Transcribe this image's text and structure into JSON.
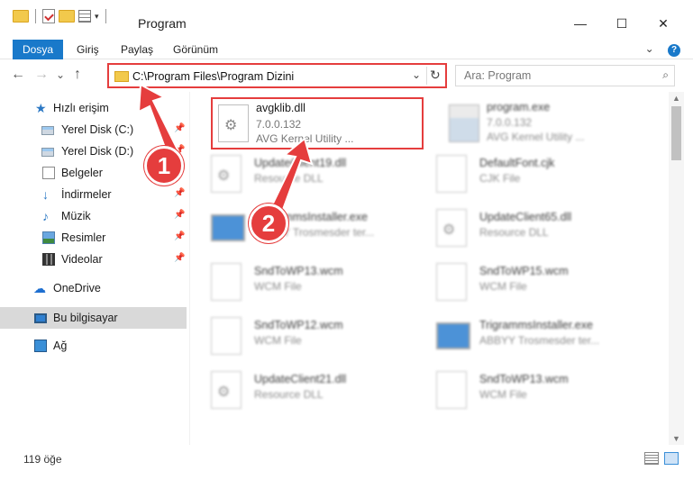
{
  "window": {
    "title": "Program",
    "minimize": "—",
    "maximize": "☐",
    "close": "✕"
  },
  "ribbon": {
    "tabs": [
      "Dosya",
      "Giriş",
      "Paylaş",
      "Görünüm"
    ],
    "expand": "⌄",
    "help": "?"
  },
  "nav": {
    "back": "←",
    "forward": "→",
    "recent": "⌄",
    "up": "↑"
  },
  "address": {
    "path": "C:\\Program Files\\Program Dizini",
    "dropdown": "⌄",
    "refresh": "↻"
  },
  "search": {
    "placeholder": "Ara: Program",
    "icon": "⌕"
  },
  "sidebar": {
    "items": [
      {
        "label": "Hızlı erişim",
        "icon": "star-icon",
        "pinned": false
      },
      {
        "label": "Yerel Disk (C:)",
        "icon": "disk-icon",
        "pinned": true
      },
      {
        "label": "Yerel Disk (D:)",
        "icon": "disk-icon",
        "pinned": true
      },
      {
        "label": "Belgeler",
        "icon": "documents-icon",
        "pinned": true
      },
      {
        "label": "İndirmeler",
        "icon": "download-icon",
        "pinned": true
      },
      {
        "label": "Müzik",
        "icon": "music-icon",
        "pinned": true
      },
      {
        "label": "Resimler",
        "icon": "pictures-icon",
        "pinned": true
      },
      {
        "label": "Videolar",
        "icon": "videos-icon",
        "pinned": true
      },
      {
        "label": "OneDrive",
        "icon": "cloud-icon",
        "pinned": false
      },
      {
        "label": "Bu bilgisayar",
        "icon": "computer-icon",
        "pinned": false,
        "selected": true
      },
      {
        "label": "Ağ",
        "icon": "network-icon",
        "pinned": false
      }
    ],
    "pin_glyph": "📌"
  },
  "files": [
    {
      "name": "avgklib.dll",
      "line1": "7.0.0.132",
      "line2": "AVG Kernel Utility ...",
      "icon": "dll-gear-icon",
      "highlighted": true
    },
    {
      "name": "program.exe",
      "line1": "7.0.0.132",
      "line2": "AVG Kernel Utility ...",
      "icon": "exe-icon"
    },
    {
      "name": "UpdateClient19.dll",
      "line1": "Resource DLL",
      "line2": "",
      "icon": "dll-gear-icon"
    },
    {
      "name": "DefaultFont.cjk",
      "line1": "CJK File",
      "line2": "",
      "icon": "file-icon"
    },
    {
      "name": "TrigrammsInstaller.exe",
      "line1": "ABBYY Trosmesder ter...",
      "line2": "",
      "icon": "installer-icon"
    },
    {
      "name": "UpdateClient65.dll",
      "line1": "Resource DLL",
      "line2": "",
      "icon": "dll-gear-icon"
    },
    {
      "name": "SndToWP13.wcm",
      "line1": "WCM File",
      "line2": "",
      "icon": "file-icon"
    },
    {
      "name": "SndToWP15.wcm",
      "line1": "WCM File",
      "line2": "",
      "icon": "file-icon"
    },
    {
      "name": "SndToWP12.wcm",
      "line1": "WCM File",
      "line2": "",
      "icon": "file-icon"
    },
    {
      "name": "TrigrammsInstaller.exe",
      "line1": "ABBYY Trosmesder ter...",
      "line2": "",
      "icon": "installer-icon"
    },
    {
      "name": "UpdateClient21.dll",
      "line1": "Resource DLL",
      "line2": "",
      "icon": "dll-gear-icon"
    },
    {
      "name": "SndToWP13.wcm",
      "line1": "WCM File",
      "line2": "",
      "icon": "file-icon"
    }
  ],
  "status": {
    "count": "119 öğe"
  },
  "annotations": {
    "badge1": "1",
    "badge2": "2"
  },
  "colors": {
    "accent": "#1979ca",
    "highlight": "#e53d3d"
  }
}
